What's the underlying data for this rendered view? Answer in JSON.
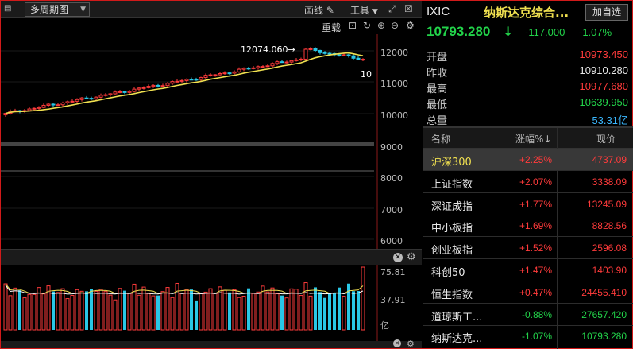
{
  "toolbar": {
    "period": "多周期图",
    "draw": "画线",
    "tools": "工具",
    "restore": "重载"
  },
  "chart": {
    "price_ticks": [
      "12000",
      "11000",
      "10000",
      "9000",
      "8000",
      "7000",
      "6000"
    ],
    "high_label": "12074.060→",
    "ma_label": "10",
    "vol_ticks": [
      "75.81",
      "37.91",
      "亿"
    ]
  },
  "quote": {
    "code": "IXIC",
    "name": "纳斯达克综合...",
    "add_button": "加自选",
    "price": "10793.280",
    "change": "-117.000",
    "change_pct": "-1.07%",
    "stats": [
      {
        "label": "开盘",
        "value": "10973.450",
        "color": "#ff3b3b"
      },
      {
        "label": "昨收",
        "value": "10910.280",
        "color": "#e8e8e8"
      },
      {
        "label": "最高",
        "value": "10977.680",
        "color": "#ff3b3b"
      },
      {
        "label": "最低",
        "value": "10639.950",
        "color": "#22d34a"
      },
      {
        "label": "总量",
        "value": "53.31亿",
        "color": "#3bb8ff"
      }
    ]
  },
  "list": {
    "headers": {
      "name": "名称",
      "pct": "涨幅%↓",
      "price": "现价"
    },
    "rows": [
      {
        "name": "沪深300",
        "pct": "+2.25%",
        "price": "4737.09",
        "color": "#ff3b3b",
        "selected": true
      },
      {
        "name": "上证指数",
        "pct": "+2.07%",
        "price": "3338.09",
        "color": "#ff3b3b"
      },
      {
        "name": "深证成指",
        "pct": "+1.77%",
        "price": "13245.09",
        "color": "#ff3b3b"
      },
      {
        "name": "中小板指",
        "pct": "+1.69%",
        "price": "8828.56",
        "color": "#ff3b3b"
      },
      {
        "name": "创业板指",
        "pct": "+1.52%",
        "price": "2596.08",
        "color": "#ff3b3b"
      },
      {
        "name": "科创50",
        "pct": "+1.47%",
        "price": "1403.90",
        "color": "#ff3b3b"
      },
      {
        "name": "恒生指数",
        "pct": "+0.47%",
        "price": "24455.410",
        "color": "#ff3b3b"
      },
      {
        "name": "道琼斯工...",
        "pct": "-0.88%",
        "price": "27657.420",
        "color": "#22d34a"
      },
      {
        "name": "纳斯达克...",
        "pct": "-1.07%",
        "price": "10793.280",
        "color": "#22d34a"
      }
    ]
  },
  "colors": {
    "up": "#ff3b3b",
    "down": "#22d34a",
    "vol_down": "#29c7e6",
    "ma": "#f0e050"
  }
}
